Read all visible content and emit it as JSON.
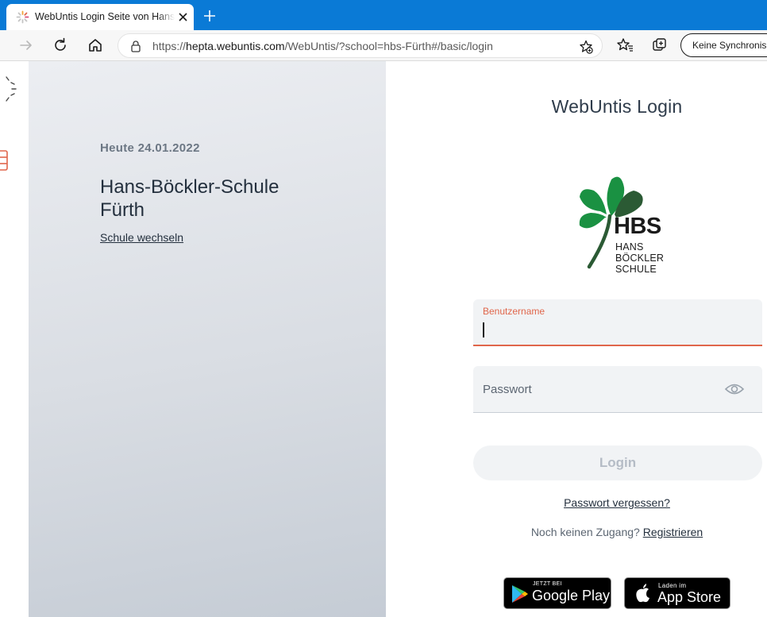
{
  "browser": {
    "tab_title": "WebUntis Login Seite von Hans-Böckler-Schule",
    "url_scheme": "https://",
    "url_host": "hepta.webuntis.com",
    "url_path": "/WebUntis/?school=hbs-Fürth#/basic/login",
    "sync_label": "Keine Synchronisierung",
    "accent_color": "#0a7ad6"
  },
  "left": {
    "date": "Heute 24.01.2022",
    "school_name": "Hans-Böckler-Schule Fürth",
    "switch_school": "Schule wechseln"
  },
  "login": {
    "title": "WebUntis Login",
    "logo_text": "HBS",
    "logo_lines": [
      "HANS",
      "BÖCKLER",
      "SCHULE"
    ],
    "username_label": "Benutzername",
    "username_value": "",
    "password_label": "Passwort",
    "login_button": "Login",
    "forgot_password": "Passwort vergessen?",
    "no_access": "Noch keinen Zugang?",
    "register": "Registrieren",
    "accent_color": "#e0664b"
  },
  "stores": {
    "google_small": "JETZT BEI",
    "google_big": "Google Play",
    "apple_small": "Laden im",
    "apple_big": "App Store"
  }
}
